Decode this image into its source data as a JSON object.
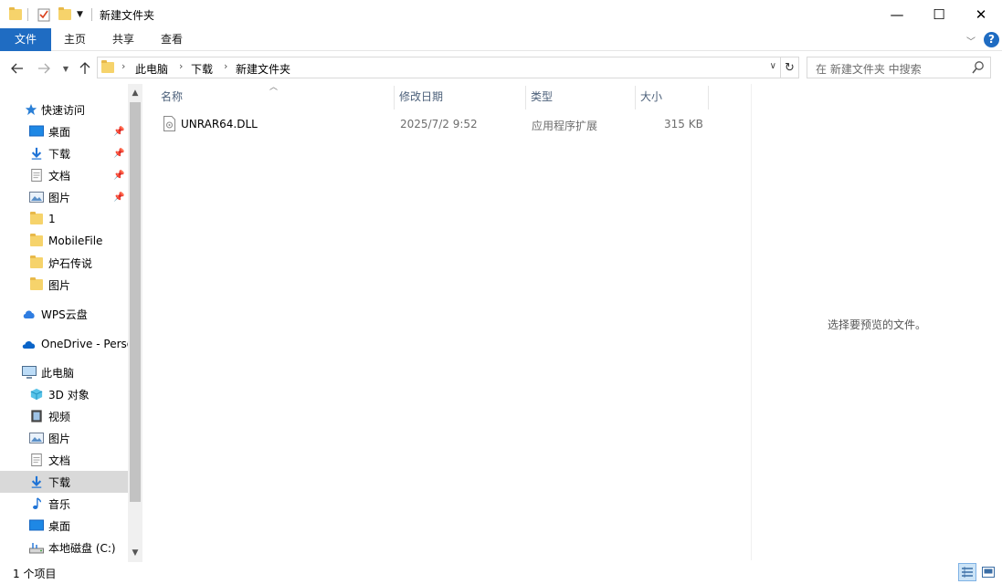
{
  "window": {
    "title": "新建文件夹",
    "minimize_glyph": "—",
    "maximize_glyph": "☐",
    "close_glyph": "✕"
  },
  "ribbon": {
    "tabs": [
      {
        "label": "文件",
        "active": true
      },
      {
        "label": "主页"
      },
      {
        "label": "共享"
      },
      {
        "label": "查看"
      }
    ],
    "help_glyph": "?"
  },
  "address": {
    "crumbs": [
      "此电脑",
      "下载",
      "新建文件夹"
    ],
    "search_placeholder": "在 新建文件夹 中搜索"
  },
  "nav": {
    "quick_access": "快速访问",
    "quick_items": [
      {
        "label": "桌面",
        "icon": "desktop-icon",
        "pinned": true
      },
      {
        "label": "下载",
        "icon": "download-icon",
        "pinned": true
      },
      {
        "label": "文档",
        "icon": "document-icon",
        "pinned": true
      },
      {
        "label": "图片",
        "icon": "picture-icon",
        "pinned": true
      },
      {
        "label": "1",
        "icon": "folder-icon"
      },
      {
        "label": "MobileFile",
        "icon": "folder-icon"
      },
      {
        "label": "炉石传说",
        "icon": "folder-icon"
      },
      {
        "label": "图片",
        "icon": "folder-icon"
      }
    ],
    "wps": "WPS云盘",
    "onedrive": "OneDrive - Perso",
    "this_pc": "此电脑",
    "pc_items": [
      {
        "label": "3D 对象",
        "icon": "cube-icon"
      },
      {
        "label": "视频",
        "icon": "video-icon"
      },
      {
        "label": "图片",
        "icon": "picture-icon"
      },
      {
        "label": "文档",
        "icon": "document-icon"
      },
      {
        "label": "下载",
        "icon": "download-icon",
        "selected": true
      },
      {
        "label": "音乐",
        "icon": "music-icon"
      },
      {
        "label": "桌面",
        "icon": "desktop-icon"
      },
      {
        "label": "本地磁盘 (C:)",
        "icon": "drive-icon"
      }
    ]
  },
  "list": {
    "columns": [
      "名称",
      "修改日期",
      "类型",
      "大小"
    ],
    "rows": [
      {
        "name": "UNRAR64.DLL",
        "modified": "2025/7/2 9:52",
        "type": "应用程序扩展",
        "size": "315 KB"
      }
    ]
  },
  "preview": {
    "message": "选择要预览的文件。"
  },
  "status": {
    "count": "1 个项目"
  },
  "colors": {
    "accent": "#1f6cc2",
    "selection": "#d9d9d9",
    "folder": "#f6d36b"
  }
}
